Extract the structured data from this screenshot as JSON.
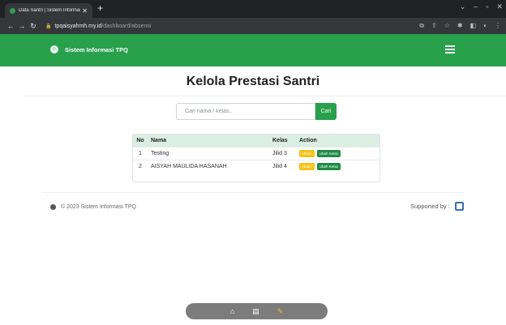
{
  "browser": {
    "tab_title": "Data Santri | Sistem Informasi TP",
    "tab_close": "✕",
    "new_tab": "+",
    "url_host": "tpqaisyahmh.my.id",
    "url_path": "/dashboard/absensi"
  },
  "navbar": {
    "brand": "Sistem Informasi TPQ"
  },
  "page": {
    "title": "Kelola Prestasi Santri"
  },
  "search": {
    "placeholder": "Cari nama / kelas..",
    "button": "Cari"
  },
  "table": {
    "headers": {
      "no": "No",
      "nama": "Nama",
      "kelas": "Kelas",
      "action": "Action"
    },
    "rows": [
      {
        "no": "1",
        "nama": "Testing",
        "kelas": "Jilid 3",
        "absen": "Absen",
        "ubah": "Ubah Kelas"
      },
      {
        "no": "2",
        "nama": "AISYAH MAULIDA HASANAH",
        "kelas": "Jilid 4",
        "absen": "Absen",
        "ubah": "Ubah Kelas"
      }
    ]
  },
  "footer": {
    "copyright": "© 2023 Sistem Informasi TPQ",
    "supported": "Supported by :"
  },
  "colors": {
    "primary": "#28a04c",
    "warning": "#f7c21a"
  }
}
